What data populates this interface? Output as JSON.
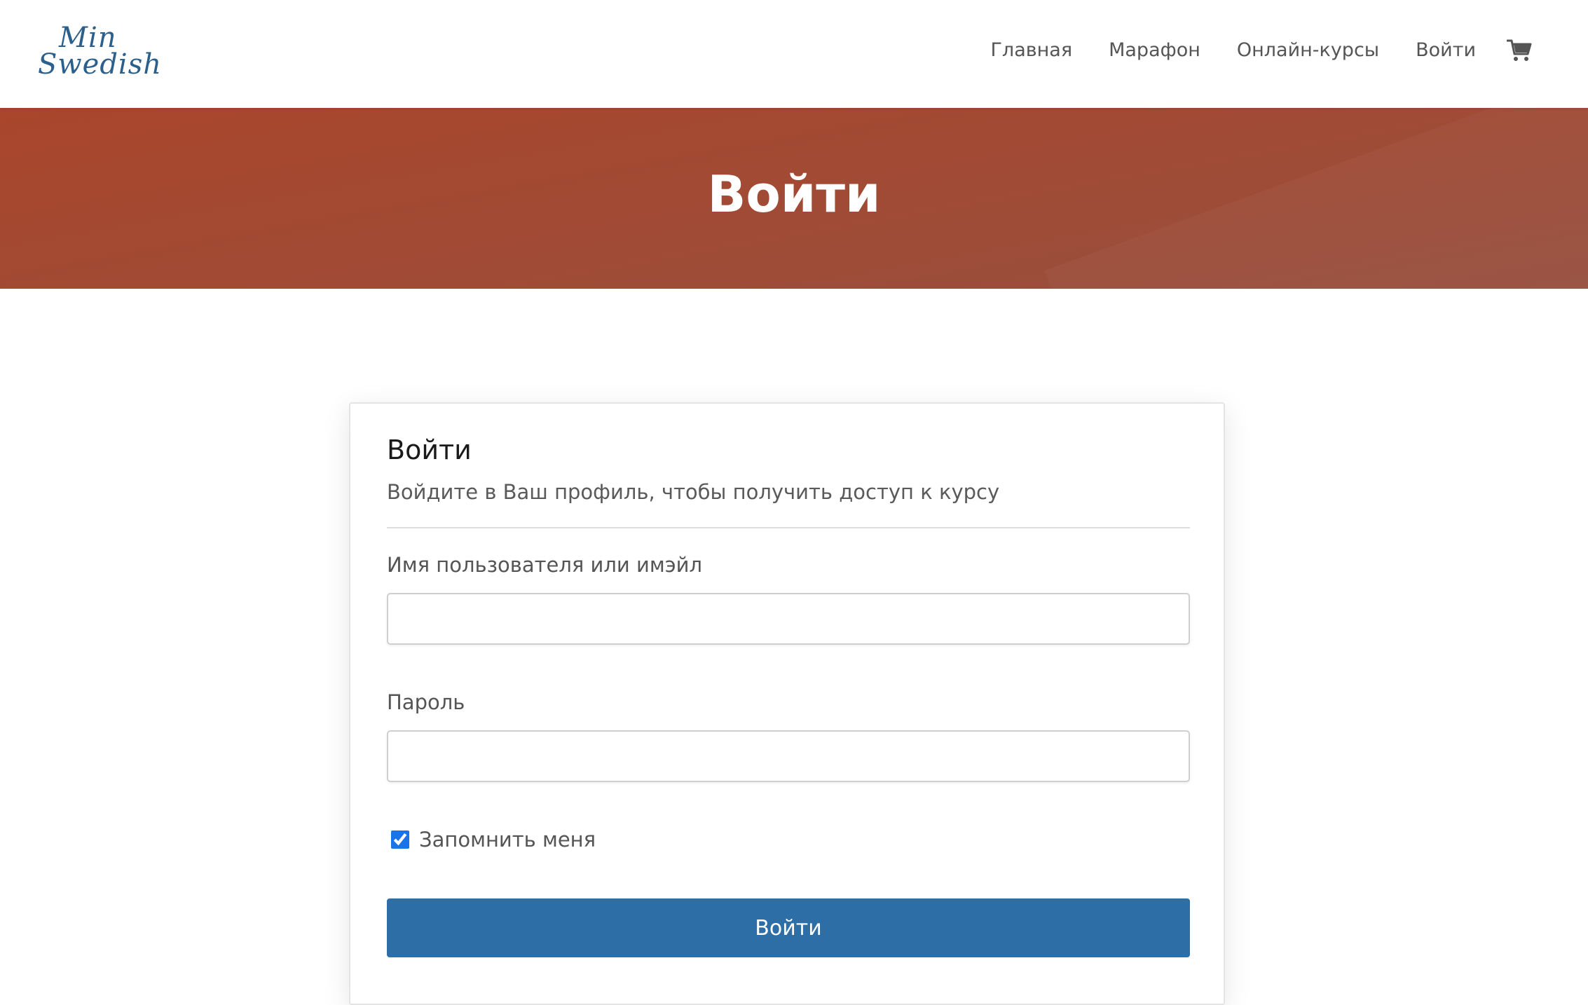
{
  "header": {
    "logo": {
      "line1": "Min",
      "line2": "Swedish"
    },
    "nav": [
      {
        "label": "Главная"
      },
      {
        "label": "Марафон"
      },
      {
        "label": "Онлайн-курсы"
      },
      {
        "label": "Войти"
      }
    ],
    "cart_icon": "shopping-cart-icon"
  },
  "hero": {
    "title": "Войти"
  },
  "login_form": {
    "title": "Войти",
    "subtitle": "Войдите в Ваш профиль, чтобы получить доступ к курсу",
    "username": {
      "label": "Имя пользователя или имэйл",
      "value": ""
    },
    "password": {
      "label": "Пароль",
      "value": ""
    },
    "remember": {
      "label": "Запомнить меня",
      "checked": true
    },
    "submit_label": "Войти"
  },
  "colors": {
    "brand_blue": "#2c6ea5",
    "logo_blue": "#2b5f8c",
    "hero_rust": "#a24a34",
    "checkbox_blue": "#1a73e8"
  }
}
